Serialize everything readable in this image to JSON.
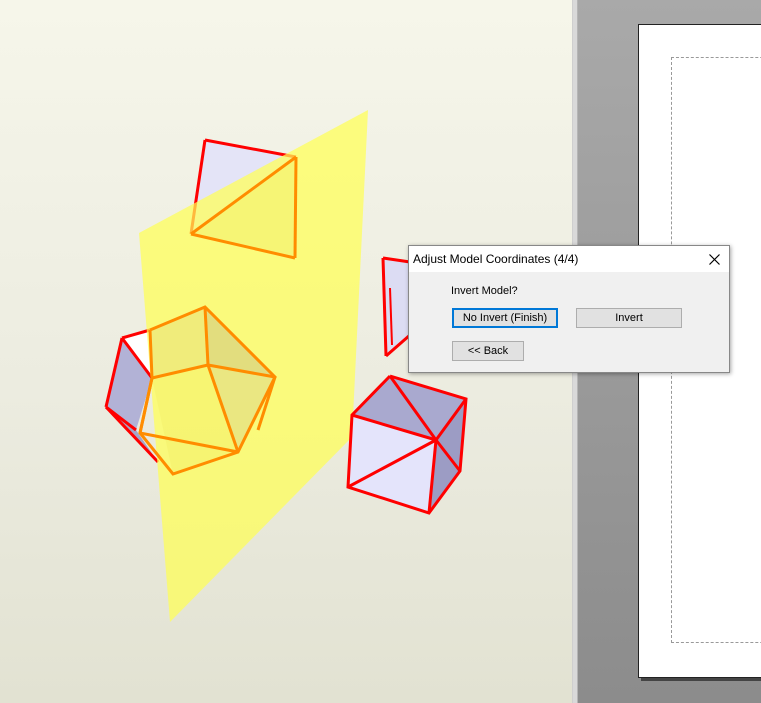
{
  "dialog": {
    "title": "Adjust Model Coordinates (4/4)",
    "close_icon": "close-icon",
    "prompt": "Invert Model?",
    "buttons": {
      "no_invert": "No Invert (Finish)",
      "invert": "Invert",
      "back": "<< Back"
    }
  },
  "colors": {
    "edge_red": "#ff0000",
    "edge_orange": "#ff8c00",
    "mirror_plane": "#ffff66",
    "face_light": "#e6e6fa",
    "face_shaded": "#a9a9c9"
  }
}
